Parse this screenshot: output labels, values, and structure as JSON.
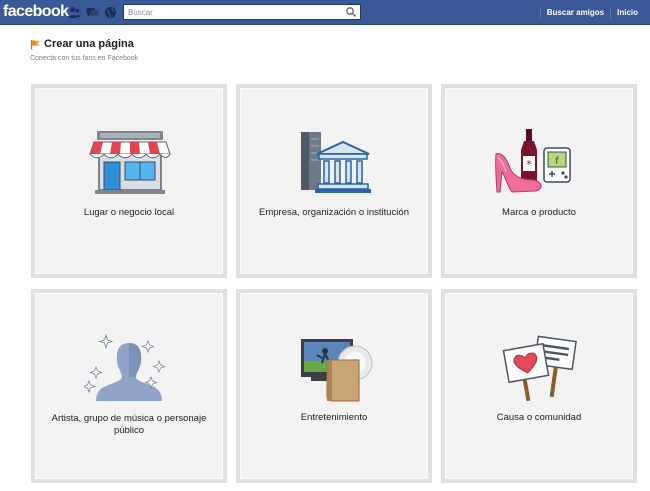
{
  "topbar": {
    "logo": "facebook",
    "search_placeholder": "Buscar",
    "links": [
      "Buscar amigos",
      "Inicio"
    ]
  },
  "header": {
    "title": "Crear una página",
    "subtitle": "Conecta con tus fans en Facebook"
  },
  "categories": [
    {
      "label": "Lugar o negocio local",
      "icon": "storefront-icon"
    },
    {
      "label": "Empresa, organización o institución",
      "icon": "building-icon"
    },
    {
      "label": "Marca o producto",
      "icon": "products-icon"
    },
    {
      "label": "Artista, grupo de música o personaje público",
      "icon": "artist-silhouette-icon"
    },
    {
      "label": "Entretenimiento",
      "icon": "entertainment-icon"
    },
    {
      "label": "Causa o comunidad",
      "icon": "protest-signs-icon"
    }
  ],
  "colors": {
    "topbar": "#3b5998",
    "card_bg": "#f2f2f2",
    "card_border": "#e0e0e0"
  }
}
